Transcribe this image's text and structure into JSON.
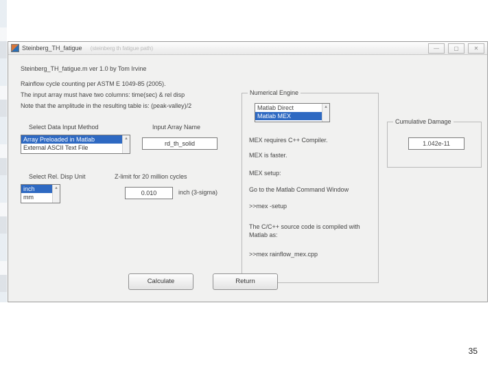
{
  "window": {
    "title": "Steinberg_TH_fatigue",
    "path_hint": "(steinberg th fatigue path)",
    "buttons": {
      "minimize": "—",
      "maximize": "▢",
      "close": "✕"
    }
  },
  "header": {
    "version_line": "Steinberg_TH_fatigue.m   ver 1.0   by Tom Irvine",
    "std_line": "Rainflow cycle counting per ASTM E 1049-85 (2005).",
    "cols_line": "The input array must have two columns: time(sec) & rel disp",
    "amp_line": "Note that the amplitude in the resulting table is:  (peak-valley)/2"
  },
  "input_method": {
    "label": "Select Data Input Method",
    "options": [
      "Array Preloaded in Matlab",
      "External ASCII Text File"
    ],
    "selected_index": 0
  },
  "input_array": {
    "label": "Input Array Name",
    "value": "rd_th_solid"
  },
  "unit": {
    "label": "Select Rel. Disp Unit",
    "options": [
      "inch",
      "mm"
    ],
    "selected_index": 0
  },
  "zlimit": {
    "label": "Z-limit for 20 million cycles",
    "value": "0.010",
    "suffix": "inch (3-sigma)"
  },
  "engine": {
    "legend": "Numerical Engine",
    "options": [
      "Matlab Direct",
      "Matlab MEX"
    ],
    "selected_index": 1,
    "notes": {
      "req": "MEX requires C++ Compiler.",
      "fast": "MEX is faster.",
      "setup_hdr": "MEX setup:",
      "setup_cmd1": "Go to the Matlab Command Window",
      "setup_cmd2": ">>mex -setup",
      "compile_hdr": "The C/C++ source code is compiled with Matlab as:",
      "compile_cmd": ">>mex rainflow_mex.cpp"
    }
  },
  "damage": {
    "legend": "Cumulative Damage",
    "value": "1.042e-11"
  },
  "buttons": {
    "calculate": "Calculate",
    "return": "Return"
  },
  "page_number": "35"
}
